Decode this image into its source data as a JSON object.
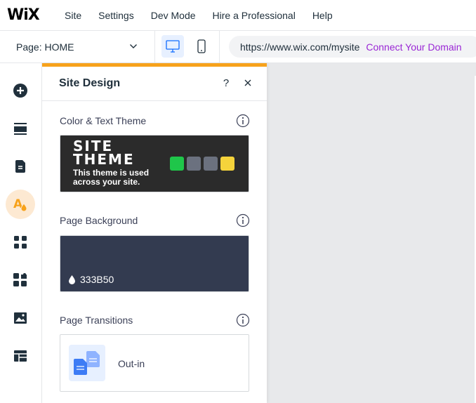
{
  "topbar": {
    "logo": "WiX",
    "menu": [
      "Site",
      "Settings",
      "Dev Mode",
      "Hire a Professional",
      "Help"
    ]
  },
  "subbar": {
    "page_selector": "Page: HOME",
    "url": "https://www.wix.com/mysite",
    "connect_domain": "Connect Your Domain",
    "device_icons": [
      "desktop-icon",
      "mobile-icon"
    ]
  },
  "rail": {
    "icons": [
      "add-icon",
      "sections-icon",
      "pages-icon",
      "site-design-icon",
      "apps-icon",
      "app-market-icon",
      "media-icon",
      "cms-icon"
    ],
    "active": "site-design-icon"
  },
  "panel": {
    "title": "Site Design",
    "help": "?",
    "sections": {
      "theme": {
        "label": "Color & Text Theme",
        "card_title_line1": "SITE",
        "card_title_line2": "THEME",
        "card_sub": "This theme is used across your site.",
        "swatches": [
          "#1fc64a",
          "#6b717f",
          "#6b717f",
          "#f5d33b"
        ]
      },
      "background": {
        "label": "Page Background",
        "color": "#333B50",
        "value": "333B50"
      },
      "transitions": {
        "label": "Page Transitions",
        "value": "Out-in"
      }
    }
  },
  "colors": {
    "accent": "#f7a21b",
    "link": "#9a27d5",
    "canvas": "#e8e9eb"
  }
}
